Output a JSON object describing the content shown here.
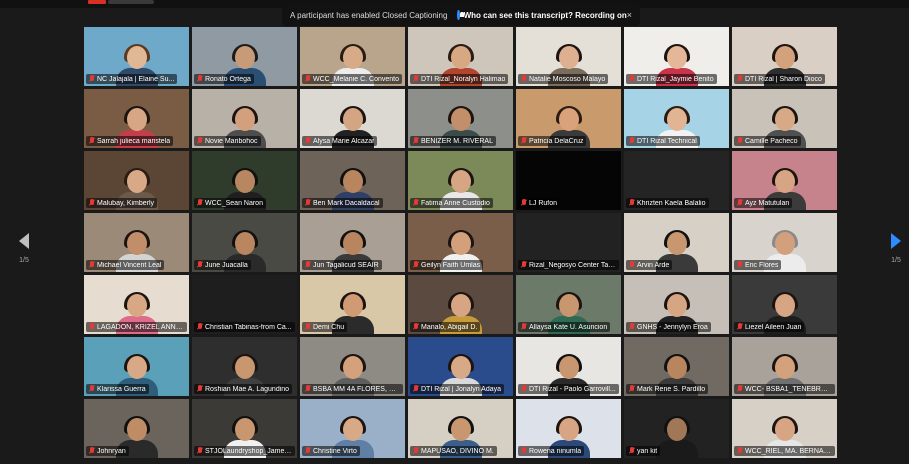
{
  "banner": {
    "message": "A participant has enabled Closed Captioning",
    "question": "Who can see this transcript? Recording on",
    "close": "×"
  },
  "pager": {
    "left_page": "1/5",
    "right_page": "1/5"
  },
  "participants": [
    {
      "name": "NC Jalajala | Elaine Su...",
      "bg": "#6fa9c9",
      "skin": "#e0b896",
      "hair": "#5a3a22",
      "shirt": "#2f4a6b",
      "active": true
    },
    {
      "name": "Ronato Ortega",
      "bg": "#8f9aa3",
      "skin": "#c89b78",
      "hair": "#1c1c1c",
      "shirt": "#2b4f73"
    },
    {
      "name": "WCC_Melanie C. Convento",
      "bg": "#b9a48c",
      "skin": "#d7ab88",
      "hair": "#2a1c14",
      "shirt": "#ececec"
    },
    {
      "name": "DTI Rizal_Noralyn Halimao",
      "bg": "#cfc6bb",
      "skin": "#d8a883",
      "hair": "#2a1c14",
      "shirt": "#b2452f"
    },
    {
      "name": "Natalie Moscoso Malayo",
      "bg": "#e4e0d8",
      "skin": "#dcb091",
      "hair": "#1d1410",
      "shirt": "#7b6d5c"
    },
    {
      "name": "DTI Rizal_Jaymie Benito",
      "bg": "#f0eeea",
      "skin": "#e3b798",
      "hair": "#1d1410",
      "shirt": "#c8344a"
    },
    {
      "name": "DTI Rizal | Sharon Dioco",
      "bg": "#d9cfc4",
      "skin": "#d3a27d",
      "hair": "#1d1410",
      "shirt": "#2e2e2e"
    },
    {
      "name": "Sarrah julieca maristela",
      "bg": "#7a5c45",
      "skin": "#d7a685",
      "hair": "#1d1410",
      "shirt": "#c23e4b"
    },
    {
      "name": "Novie Maribohoc",
      "bg": "#b8b1a7",
      "skin": "#d2a07c",
      "hair": "#1d1410",
      "shirt": "#4d4d4d"
    },
    {
      "name": "Alysa Marie Alcazar",
      "bg": "#dcd8d2",
      "skin": "#d4a583",
      "hair": "#1d1410",
      "shirt": "#222222"
    },
    {
      "name": "BENIZER M. RIVERAL",
      "bg": "#8c8f8a",
      "skin": "#c28f6a",
      "hair": "#1d1410",
      "shirt": "#3c4a4a"
    },
    {
      "name": "Patricia DelaCruz",
      "bg": "#c99a6c",
      "skin": "#d9a27a",
      "hair": "#2a1c14",
      "shirt": "#3a3a3a"
    },
    {
      "name": "DTI Rizal Technical",
      "bg": "#a7d3e6",
      "skin": "#e1b493",
      "hair": "#2a1c14",
      "shirt": "#f2f2f2"
    },
    {
      "name": "Camille Pacheco",
      "bg": "#c9c2b8",
      "skin": "#d8a987",
      "hair": "#1d1410",
      "shirt": "#505050"
    },
    {
      "name": "Malubay, Kimberly",
      "bg": "#5b4636",
      "skin": "#d8a987",
      "hair": "#2a1c14",
      "shirt": "#6b5a4a"
    },
    {
      "name": "WCC_Sean Naron",
      "bg": "#2f3b2b",
      "skin": "#b88762",
      "hair": "#111111",
      "shirt": "#1f1f1f"
    },
    {
      "name": "Ben Mark Dacaldacal",
      "bg": "#6e6358",
      "skin": "#b9855f",
      "hair": "#111111",
      "shirt": "#2f3f66"
    },
    {
      "name": "Fatima Anne Custodio",
      "bg": "#7c8a5a",
      "skin": "#d6a684",
      "hair": "#1d1410",
      "shirt": "#e8e8e8"
    },
    {
      "name": "LJ Rufon",
      "bg": "#050505",
      "skin": "#050505",
      "hair": "#050505",
      "shirt": "#050505"
    },
    {
      "name": "Khrizten Kaela Balalio",
      "bg": "#242424",
      "skin": "#242424",
      "hair": "#242424",
      "shirt": "#242424"
    },
    {
      "name": "Ayz Matutulan",
      "bg": "#c7838c",
      "skin": "#d7a584",
      "hair": "#1d1410",
      "shirt": "#3b3b3b"
    },
    {
      "name": "Michael Vincent Leal",
      "bg": "#9c8a78",
      "skin": "#c18e69",
      "hair": "#1d1410",
      "shirt": "#d3d3d3"
    },
    {
      "name": "June Juacalla",
      "bg": "#4a4a44",
      "skin": "#b98660",
      "hair": "#111111",
      "shirt": "#2a2a2a"
    },
    {
      "name": "Jun Tagalicud SEAIR",
      "bg": "#a99f95",
      "skin": "#b9855f",
      "hair": "#111111",
      "shirt": "#3a3a3a"
    },
    {
      "name": "Geilyn Faith Umlas",
      "bg": "#7a5e4a",
      "skin": "#d3a07c",
      "hair": "#1d1410",
      "shirt": "#f0f0f0"
    },
    {
      "name": "Rizal_Negosyo Center Tan...",
      "bg": "#222222",
      "skin": "#222222",
      "hair": "#222222",
      "shirt": "#222222"
    },
    {
      "name": "Arvin Arde",
      "bg": "#d6d0c6",
      "skin": "#c8966f",
      "hair": "#111111",
      "shirt": "#3a3a3a"
    },
    {
      "name": "Eric Flores",
      "bg": "#d8d4cd",
      "skin": "#d2a07c",
      "hair": "#8a8a8a",
      "shirt": "#ececec"
    },
    {
      "name": "LAGADON, KRIZEL ANNE ...",
      "bg": "#e6dccf",
      "skin": "#d8a885",
      "hair": "#1d1410",
      "shirt": "#dd6b8a"
    },
    {
      "name": "Christian Tabinas-from Ca...",
      "bg": "#1e1e1e",
      "skin": "#1e1e1e",
      "hair": "#1e1e1e",
      "shirt": "#1e1e1e"
    },
    {
      "name": "Demi Chu",
      "bg": "#d8c8a8",
      "skin": "#d09a73",
      "hair": "#1d1410",
      "shirt": "#2b2b2b"
    },
    {
      "name": "Manalo, Abigail D.",
      "bg": "#5a4a40",
      "skin": "#d7a584",
      "hair": "#1d1410",
      "shirt": "#c79b3a"
    },
    {
      "name": "Allaysa Kate U. Asuncion",
      "bg": "#6c7a6a",
      "skin": "#c8966f",
      "hair": "#1d1410",
      "shirt": "#2f6b52"
    },
    {
      "name": "GNHS - Jennylyn Eroa",
      "bg": "#c6bfb7",
      "skin": "#d6a584",
      "hair": "#1d1410",
      "shirt": "#222222"
    },
    {
      "name": "Liezel Aileen Juan",
      "bg": "#3a3a3a",
      "skin": "#d7a584",
      "hair": "#1d1410",
      "shirt": "#1d1d1d"
    },
    {
      "name": "Klarissa Guerra",
      "bg": "#5aa0b8",
      "skin": "#d8a987",
      "hair": "#1d1410",
      "shirt": "#2f5d7c"
    },
    {
      "name": "Roshian Mae A. Lagundino",
      "bg": "#2e2e2e",
      "skin": "#c8966f",
      "hair": "#1d1410",
      "shirt": "#3f3f3f"
    },
    {
      "name": "BSBA MM 4A FLORES, KR...",
      "bg": "#8e8a84",
      "skin": "#d3a27d",
      "hair": "#1d1410",
      "shirt": "#5e5e5e"
    },
    {
      "name": "DTI Rizal | Jonalyn Adaya",
      "bg": "#2a4b8c",
      "skin": "#d8a987",
      "hair": "#1d1410",
      "shirt": "#d9d9d9"
    },
    {
      "name": "DTI Rizal - Paolo Garrovill...",
      "bg": "#e8e6e2",
      "skin": "#c8966f",
      "hair": "#111111",
      "shirt": "#2a2a2a"
    },
    {
      "name": "Mark Rene S. Pardillo",
      "bg": "#706a62",
      "skin": "#b9855f",
      "hair": "#111111",
      "shirt": "#3a3a3a"
    },
    {
      "name": "WCC- BSBA1_TENEBROS...",
      "bg": "#a8a29a",
      "skin": "#d3a27d",
      "hair": "#1d1410",
      "shirt": "#707070"
    },
    {
      "name": "Johnryan",
      "bg": "#6a645c",
      "skin": "#c08c66",
      "hair": "#111111",
      "shirt": "#2a2a2a"
    },
    {
      "name": "STJOLaundryshop_James...",
      "bg": "#3c3a36",
      "skin": "#c8966f",
      "hair": "#111111",
      "shirt": "#f0f0f0"
    },
    {
      "name": "Christine Virto",
      "bg": "#9ab0c8",
      "skin": "#d8a987",
      "hair": "#1d1410",
      "shirt": "#5f7fa5"
    },
    {
      "name": "MAPUSAO, DIVINO M.",
      "bg": "#d6cfc4",
      "skin": "#c8966f",
      "hair": "#111111",
      "shirt": "#3b5f8a"
    },
    {
      "name": "Rowena ninumla",
      "bg": "#dde2ea",
      "skin": "#d7a584",
      "hair": "#1d1410",
      "shirt": "#2b4a7a"
    },
    {
      "name": "yan kit",
      "bg": "#222222",
      "skin": "#a07858",
      "hair": "#111111",
      "shirt": "#1a1a1a"
    },
    {
      "name": "WCC_RIEL, MA. BERNADE...",
      "bg": "#d7d0c6",
      "skin": "#d7a584",
      "hair": "#1d1410",
      "shirt": "#e6e6e6"
    }
  ]
}
